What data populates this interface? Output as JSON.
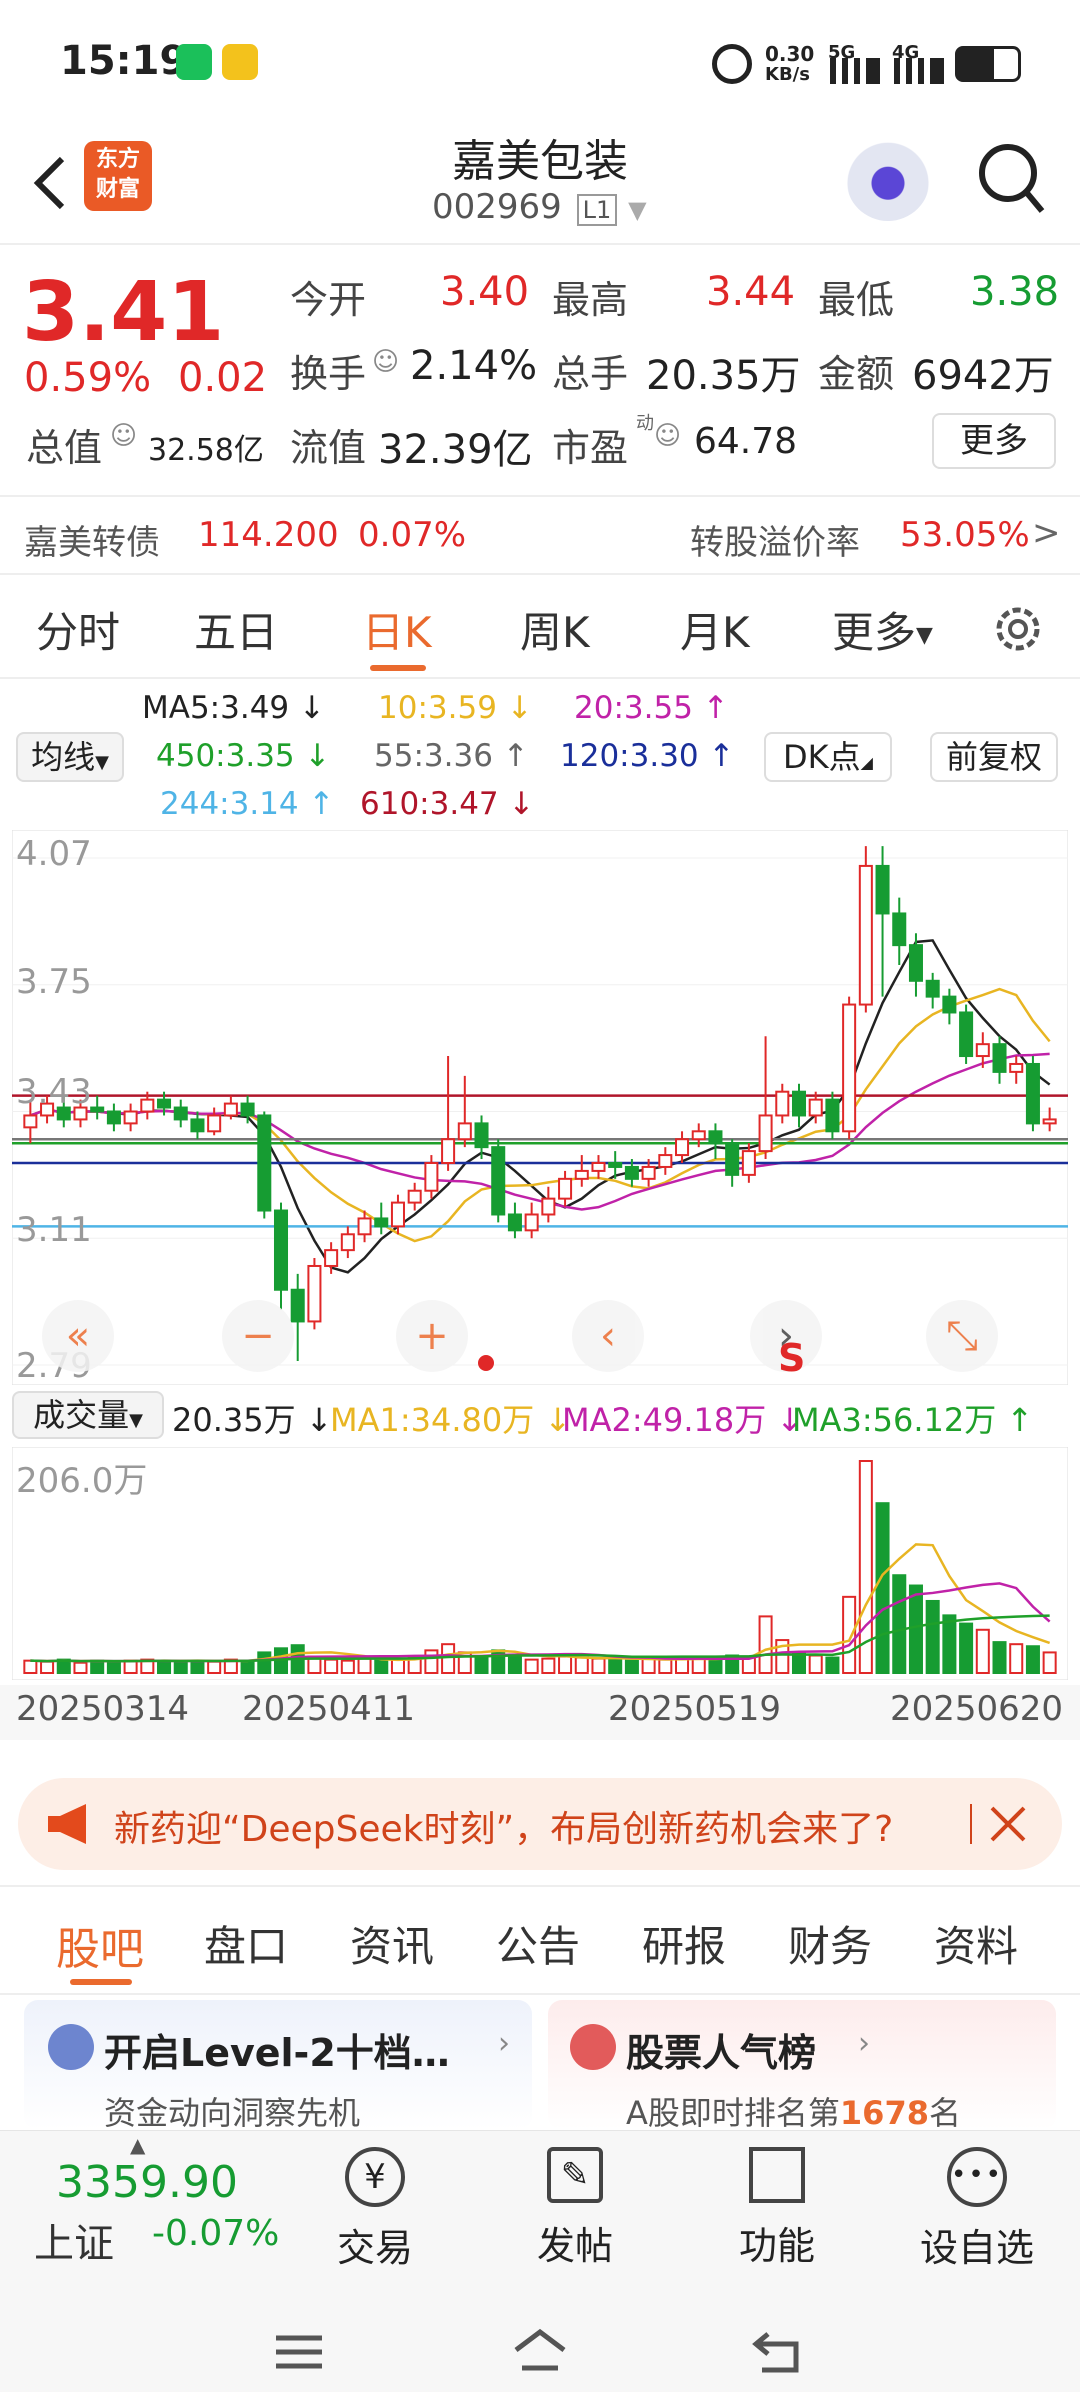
{
  "status": {
    "time": "15:19",
    "speed_value": "0.30",
    "speed_unit": "KB/s",
    "net1": "5G",
    "net2": "4G"
  },
  "nav": {
    "logo_line1": "东方",
    "logo_line2": "财富",
    "title": "嘉美包装",
    "code": "002969",
    "level": "L1"
  },
  "quote": {
    "price": "3.41",
    "change_pct": "0.59%",
    "change": "0.02",
    "open_label": "今开",
    "open": "3.40",
    "high_label": "最高",
    "high": "3.44",
    "low_label": "最低",
    "low": "3.38",
    "turnover_label": "换手",
    "turnover": "2.14%",
    "volume_label": "总手",
    "volume": "20.35万",
    "amount_label": "金额",
    "amount": "6942万",
    "mktcap_label": "总值",
    "mktcap": "32.58亿",
    "float_label": "流值",
    "float": "32.39亿",
    "pe_label": "市盈",
    "pe_sup": "动",
    "pe": "64.78",
    "more": "更多"
  },
  "bond": {
    "name": "嘉美转债",
    "price": "114.200",
    "pct": "0.07%",
    "premium_label": "转股溢价率",
    "premium": "53.05%",
    "arrow": ">"
  },
  "ktabs": {
    "t1": "分时",
    "t2": "五日",
    "t3": "日K",
    "t4": "周K",
    "t5": "月K",
    "t6": "更多"
  },
  "ma": {
    "select": "均线",
    "ma5": "MA5:3.49 ↓",
    "ma10": "10:3.59 ↓",
    "ma20": "20:3.55 ↑",
    "ma450": "450:3.35 ↓",
    "ma55": "55:3.36 ↑",
    "ma120": "120:3.30 ↑",
    "ma244": "244:3.14 ↑",
    "ma610": "610:3.47 ↓",
    "dk": "DK点",
    "fq": "前复权"
  },
  "yaxis": {
    "y1": "4.07",
    "y2": "3.75",
    "y3": "3.43",
    "y4": "3.11",
    "y5": "2.79"
  },
  "vol": {
    "select": "成交量",
    "val": "20.35万 ↓",
    "ma1": "MA1:34.80万 ↓",
    "ma2": "MA2:49.18万 ↓",
    "ma3": "MA3:56.12万 ↑",
    "max": "206.0万"
  },
  "dates": {
    "d1": "20250314",
    "d2": "20250411",
    "d3": "20250519",
    "d4": "20250620"
  },
  "banner": {
    "text": "新药迎“DeepSeek时刻”，布局创新药机会来了?"
  },
  "btabs": {
    "t1": "股吧",
    "t2": "盘口",
    "t3": "资讯",
    "t4": "公告",
    "t5": "研报",
    "t6": "财务",
    "t7": "资料"
  },
  "cards": {
    "c1_title": "开启Level-2十档…",
    "c1_sub": "资金动向洞察先机",
    "c2_title": "股票人气榜",
    "c2_sub_pre": "A股即时排名第",
    "c2_rank": "1678",
    "c2_sub_post": "名"
  },
  "bottom": {
    "index_value": "3359.90",
    "index_name": "上证",
    "index_pct": "-0.07%",
    "b1": "交易",
    "b2": "发帖",
    "b3": "功能",
    "b4": "设自选"
  },
  "chart_data": {
    "type": "candlestick",
    "ylim": [
      2.79,
      4.07
    ],
    "y_ticks": [
      4.07,
      3.75,
      3.43,
      3.11,
      2.79
    ],
    "x_ticks": [
      "20250314",
      "20250411",
      "20250519",
      "20250620"
    ],
    "candles": [
      [
        3.39,
        3.42,
        3.46,
        3.35
      ],
      [
        3.42,
        3.45,
        3.47,
        3.4
      ],
      [
        3.44,
        3.41,
        3.47,
        3.39
      ],
      [
        3.41,
        3.44,
        3.46,
        3.39
      ],
      [
        3.44,
        3.43,
        3.47,
        3.41
      ],
      [
        3.43,
        3.4,
        3.45,
        3.38
      ],
      [
        3.4,
        3.43,
        3.45,
        3.38
      ],
      [
        3.43,
        3.46,
        3.48,
        3.41
      ],
      [
        3.46,
        3.44,
        3.48,
        3.42
      ],
      [
        3.44,
        3.41,
        3.46,
        3.39
      ],
      [
        3.41,
        3.38,
        3.43,
        3.36
      ],
      [
        3.38,
        3.42,
        3.44,
        3.37
      ],
      [
        3.42,
        3.45,
        3.47,
        3.41
      ],
      [
        3.45,
        3.42,
        3.47,
        3.4
      ],
      [
        3.42,
        3.18,
        3.43,
        3.16
      ],
      [
        3.18,
        2.98,
        3.2,
        2.93
      ],
      [
        2.98,
        2.9,
        3.02,
        2.8
      ],
      [
        2.9,
        3.04,
        3.06,
        2.88
      ],
      [
        3.04,
        3.08,
        3.1,
        3.02
      ],
      [
        3.08,
        3.12,
        3.14,
        3.06
      ],
      [
        3.12,
        3.16,
        3.18,
        3.1
      ],
      [
        3.16,
        3.14,
        3.2,
        3.12
      ],
      [
        3.14,
        3.2,
        3.22,
        3.12
      ],
      [
        3.2,
        3.23,
        3.25,
        3.18
      ],
      [
        3.23,
        3.3,
        3.32,
        3.21
      ],
      [
        3.3,
        3.36,
        3.57,
        3.28
      ],
      [
        3.36,
        3.4,
        3.52,
        3.34
      ],
      [
        3.4,
        3.34,
        3.42,
        3.31
      ],
      [
        3.34,
        3.17,
        3.36,
        3.15
      ],
      [
        3.17,
        3.13,
        3.2,
        3.11
      ],
      [
        3.13,
        3.17,
        3.2,
        3.11
      ],
      [
        3.17,
        3.21,
        3.24,
        3.15
      ],
      [
        3.21,
        3.26,
        3.28,
        3.19
      ],
      [
        3.26,
        3.28,
        3.32,
        3.24
      ],
      [
        3.28,
        3.3,
        3.32,
        3.26
      ],
      [
        3.3,
        3.29,
        3.33,
        3.26
      ],
      [
        3.29,
        3.26,
        3.31,
        3.24
      ],
      [
        3.26,
        3.29,
        3.31,
        3.24
      ],
      [
        3.29,
        3.32,
        3.34,
        3.27
      ],
      [
        3.32,
        3.36,
        3.38,
        3.3
      ],
      [
        3.36,
        3.38,
        3.4,
        3.34
      ],
      [
        3.38,
        3.35,
        3.4,
        3.31
      ],
      [
        3.35,
        3.27,
        3.36,
        3.24
      ],
      [
        3.27,
        3.33,
        3.35,
        3.25
      ],
      [
        3.33,
        3.42,
        3.62,
        3.31
      ],
      [
        3.42,
        3.48,
        3.5,
        3.4
      ],
      [
        3.48,
        3.42,
        3.5,
        3.39
      ],
      [
        3.42,
        3.46,
        3.48,
        3.4
      ],
      [
        3.46,
        3.38,
        3.48,
        3.36
      ],
      [
        3.38,
        3.7,
        3.72,
        3.36
      ],
      [
        3.7,
        4.05,
        4.1,
        3.68
      ],
      [
        4.05,
        3.93,
        4.1,
        3.72
      ],
      [
        3.93,
        3.85,
        3.97,
        3.8
      ],
      [
        3.85,
        3.76,
        3.88,
        3.72
      ],
      [
        3.76,
        3.72,
        3.78,
        3.69
      ],
      [
        3.72,
        3.68,
        3.74,
        3.65
      ],
      [
        3.68,
        3.57,
        3.7,
        3.55
      ],
      [
        3.57,
        3.6,
        3.63,
        3.54
      ],
      [
        3.6,
        3.53,
        3.62,
        3.5
      ],
      [
        3.53,
        3.55,
        3.57,
        3.5
      ],
      [
        3.55,
        3.4,
        3.57,
        3.38
      ],
      [
        3.4,
        3.41,
        3.44,
        3.38
      ]
    ],
    "volumes": [
      12,
      11,
      13,
      10,
      12,
      11,
      12,
      13,
      12,
      11,
      12,
      11,
      13,
      12,
      20,
      24,
      27,
      16,
      13,
      12,
      14,
      12,
      13,
      15,
      22,
      28,
      20,
      16,
      22,
      17,
      13,
      14,
      16,
      15,
      14,
      13,
      12,
      14,
      13,
      15,
      14,
      12,
      17,
      15,
      55,
      32,
      19,
      17,
      15,
      74,
      206,
      165,
      95,
      85,
      70,
      56,
      48,
      42,
      30,
      28,
      26,
      20
    ],
    "ma_lines": {
      "MA5": 3.49,
      "MA10": 3.59,
      "MA20": 3.55,
      "MA450": 3.35,
      "MA55": 3.36,
      "MA120": 3.3,
      "MA244": 3.14,
      "MA610": 3.47
    }
  },
  "colors": {
    "up": "#e02828",
    "down": "#169c32",
    "accent": "#ea6a2e"
  }
}
